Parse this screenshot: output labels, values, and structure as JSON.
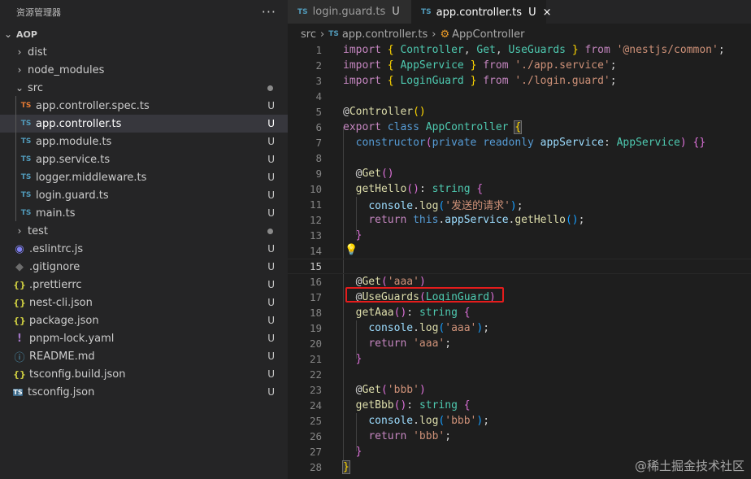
{
  "explorer": {
    "title": "资源管理器",
    "more": "···",
    "root": "AOP",
    "items": [
      {
        "label": "dist",
        "kind": "folder",
        "status": ""
      },
      {
        "label": "node_modules",
        "kind": "folder",
        "status": ""
      },
      {
        "label": "src",
        "kind": "folder-open",
        "status": "dot"
      },
      {
        "label": "app.controller.spec.ts",
        "kind": "ts-spec",
        "status": "U"
      },
      {
        "label": "app.controller.ts",
        "kind": "ts",
        "status": "U"
      },
      {
        "label": "app.module.ts",
        "kind": "ts",
        "status": "U"
      },
      {
        "label": "app.service.ts",
        "kind": "ts",
        "status": "U"
      },
      {
        "label": "logger.middleware.ts",
        "kind": "ts",
        "status": "U"
      },
      {
        "label": "login.guard.ts",
        "kind": "ts",
        "status": "U"
      },
      {
        "label": "main.ts",
        "kind": "ts",
        "status": "U"
      },
      {
        "label": "test",
        "kind": "folder",
        "status": "dot"
      },
      {
        "label": ".eslintrc.js",
        "kind": "eslint",
        "status": "U"
      },
      {
        "label": ".gitignore",
        "kind": "git",
        "status": "U"
      },
      {
        "label": ".prettierrc",
        "kind": "json",
        "status": "U"
      },
      {
        "label": "nest-cli.json",
        "kind": "json",
        "status": "U"
      },
      {
        "label": "package.json",
        "kind": "json",
        "status": "U"
      },
      {
        "label": "pnpm-lock.yaml",
        "kind": "yaml",
        "status": "U"
      },
      {
        "label": "README.md",
        "kind": "info",
        "status": "U"
      },
      {
        "label": "tsconfig.build.json",
        "kind": "json",
        "status": "U"
      },
      {
        "label": "tsconfig.json",
        "kind": "tsconfig",
        "status": "U"
      }
    ]
  },
  "tabs": [
    {
      "icon": "TS",
      "label": "login.guard.ts",
      "status": "U"
    },
    {
      "icon": "TS",
      "label": "app.controller.ts",
      "status": "U",
      "close": "×"
    }
  ],
  "breadcrumb": {
    "folder": "src",
    "file": "app.controller.ts",
    "symbol": "AppController"
  },
  "code": {
    "line_numbers": [
      "1",
      "2",
      "3",
      "4",
      "5",
      "6",
      "7",
      "8",
      "9",
      "10",
      "11",
      "12",
      "13",
      "14",
      "15",
      "16",
      "17",
      "18",
      "19",
      "20",
      "21",
      "22",
      "23",
      "24",
      "25",
      "26",
      "27",
      "28"
    ],
    "line1": {
      "a": "import",
      "b": "{",
      "c": "Controller",
      "d": ",",
      "e": "Get",
      "f": ",",
      "g": "UseGuards",
      "h": "}",
      "i": "from",
      "j": "'@nestjs/common'",
      "k": ";"
    },
    "line2": {
      "a": "import",
      "b": "{",
      "c": "AppService",
      "d": "}",
      "e": "from",
      "f": "'./app.service'",
      "g": ";"
    },
    "line3": {
      "a": "import",
      "b": "{",
      "c": "LoginGuard",
      "d": "}",
      "e": "from",
      "f": "'./login.guard'",
      "g": ";"
    },
    "line5": {
      "a": "@",
      "b": "Controller",
      "c": "()"
    },
    "line6": {
      "a": "export",
      "b": "class",
      "c": "AppController",
      "d": "{"
    },
    "line7": {
      "a": "constructor",
      "b": "(",
      "c": "private",
      "d": "readonly",
      "e": "appService",
      "f": ":",
      "g": "AppService",
      "h": ")",
      "i": "{}"
    },
    "line9": {
      "a": "@",
      "b": "Get",
      "c": "()"
    },
    "line10": {
      "a": "getHello",
      "b": "()",
      "c": ":",
      "d": "string",
      "e": "{"
    },
    "line11": {
      "a": "console",
      "b": ".",
      "c": "log",
      "d": "(",
      "e": "'发送的请求'",
      "f": ")",
      "g": ";"
    },
    "line12": {
      "a": "return",
      "b": "this",
      "c": ".",
      "d": "appService",
      "e": ".",
      "f": "getHello",
      "g": "()",
      "h": ";"
    },
    "line13": {
      "a": "}"
    },
    "line16": {
      "a": "@",
      "b": "Get",
      "c": "(",
      "d": "'aaa'",
      "e": ")"
    },
    "line17": {
      "a": "@",
      "b": "UseGuards",
      "c": "(",
      "d": "LoginGuard",
      "e": ")"
    },
    "line18": {
      "a": "getAaa",
      "b": "()",
      "c": ":",
      "d": "string",
      "e": "{"
    },
    "line19": {
      "a": "console",
      "b": ".",
      "c": "log",
      "d": "(",
      "e": "'aaa'",
      "f": ")",
      "g": ";"
    },
    "line20": {
      "a": "return",
      "b": "'aaa'",
      "c": ";"
    },
    "line21": {
      "a": "}"
    },
    "line23": {
      "a": "@",
      "b": "Get",
      "c": "(",
      "d": "'bbb'",
      "e": ")"
    },
    "line24": {
      "a": "getBbb",
      "b": "()",
      "c": ":",
      "d": "string",
      "e": "{"
    },
    "line25": {
      "a": "console",
      "b": ".",
      "c": "log",
      "d": "(",
      "e": "'bbb'",
      "f": ")",
      "g": ";"
    },
    "line26": {
      "a": "return",
      "b": "'bbb'",
      "c": ";"
    },
    "line27": {
      "a": "}"
    },
    "line28": {
      "a": "}"
    }
  },
  "watermark": "@稀土掘金技术社区"
}
